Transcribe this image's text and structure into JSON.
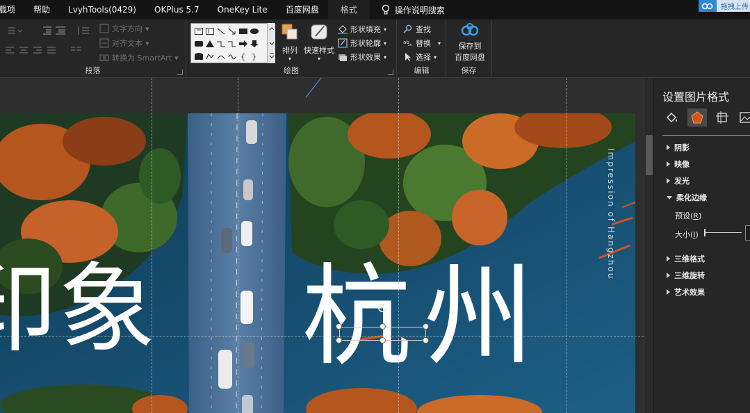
{
  "menubar": {
    "items": [
      "加载项",
      "帮助",
      "LvyhTools(0429)",
      "OKPlus 5.7",
      "OneKey Lite",
      "百度网盘",
      "格式"
    ],
    "active_index": 6,
    "tell_me": "操作说明搜索",
    "badge_text": "拖拽上传"
  },
  "ribbon": {
    "paragraph": {
      "label": "段落",
      "text_direction": "文字方向",
      "align_text": "对齐文本",
      "convert_smartart": "转换为 SmartArt"
    },
    "drawing": {
      "label": "绘图",
      "arrange": "排列",
      "quick_styles": "快速样式",
      "shape_fill": "形状填充",
      "shape_outline": "形状轮廓",
      "shape_effects": "形状效果"
    },
    "editing": {
      "label": "编辑",
      "find": "查找",
      "replace": "替换",
      "select": "选择"
    },
    "save": {
      "label": "保存",
      "save_to_baidu_line1": "保存到",
      "save_to_baidu_line2": "百度网盘"
    }
  },
  "slide": {
    "title_left": "印象",
    "title_right": "杭州",
    "vertical_caption": "Impression of Hangzhou"
  },
  "pane": {
    "title": "设置图片格式",
    "tabs": [
      "fill-line-icon",
      "effects-icon",
      "size-properties-icon",
      "picture-icon"
    ],
    "active_tab": 1,
    "sections": {
      "shadow": "阴影",
      "reflection": "映像",
      "glow": "发光",
      "soft_edges": "柔化边缘",
      "preset": "预设(",
      "preset_key": "R",
      "size": "大小(",
      "size_key": "I",
      "format_3d": "三维格式",
      "rotation_3d": "三维旋转",
      "artistic": "艺术效果"
    }
  },
  "colors": {
    "menubar_bg": "#141414",
    "ribbon_bg": "#262626",
    "canvas_bg": "#2e2e2e",
    "accent_orange": "#d2541f",
    "water_blue": "#1d5f86"
  }
}
